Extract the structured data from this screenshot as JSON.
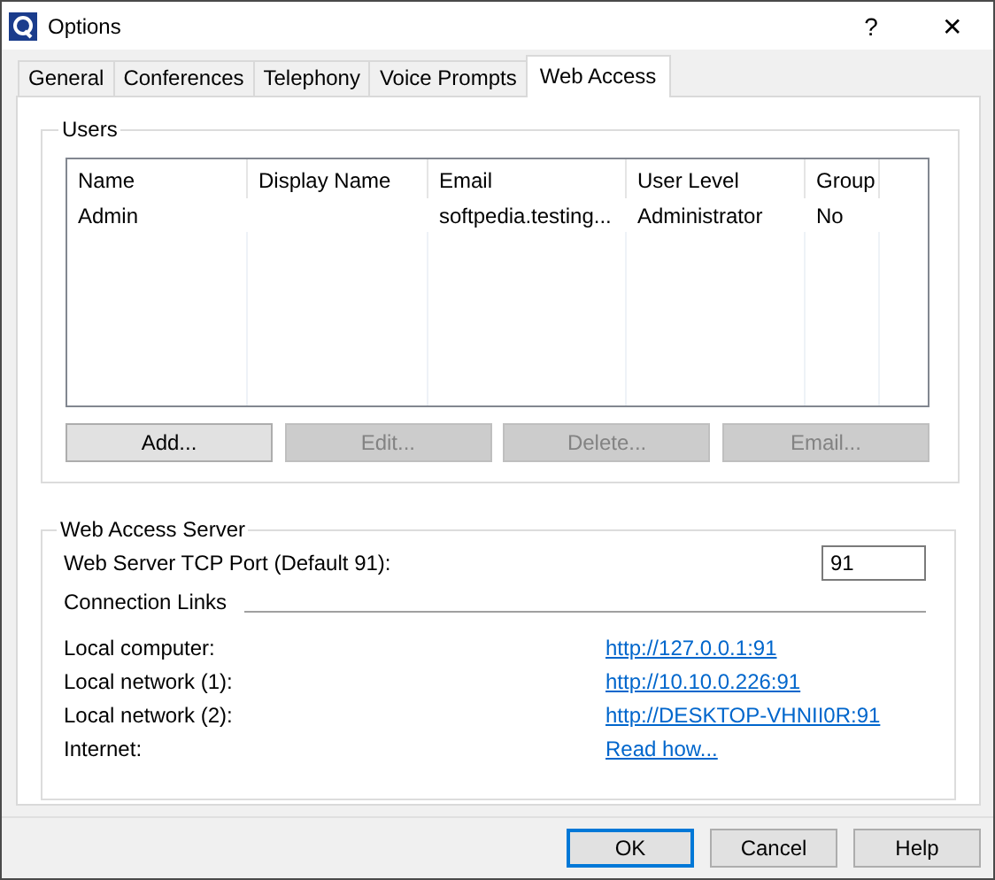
{
  "window": {
    "title": "Options",
    "help_glyph": "?",
    "close_glyph": "✕"
  },
  "tabs": [
    {
      "label": "General",
      "selected": false
    },
    {
      "label": "Conferences",
      "selected": false
    },
    {
      "label": "Telephony",
      "selected": false
    },
    {
      "label": "Voice Prompts",
      "selected": false
    },
    {
      "label": "Web Access",
      "selected": true
    }
  ],
  "users": {
    "title": "Users",
    "columns": [
      "Name",
      "Display Name",
      "Email",
      "User Level",
      "Group"
    ],
    "rows": [
      [
        "Admin",
        "",
        "softpedia.testing...",
        "Administrator",
        "No"
      ]
    ],
    "buttons": [
      {
        "label": "Add...",
        "disabled": false
      },
      {
        "label": "Edit...",
        "disabled": true
      },
      {
        "label": "Delete...",
        "disabled": true
      },
      {
        "label": "Email...",
        "disabled": true
      }
    ]
  },
  "server": {
    "title": "Web Access Server",
    "port_label": "Web Server TCP Port (Default 91):",
    "port_value": "91",
    "links_heading": "Connection Links",
    "links": [
      {
        "label": "Local computer:",
        "link": "http://127.0.0.1:91"
      },
      {
        "label": "Local network (1):",
        "link": "http://10.10.0.226:91"
      },
      {
        "label": "Local network (2):",
        "link": "http://DESKTOP-VHNII0R:91"
      },
      {
        "label": "Internet:",
        "link": "Read how..."
      }
    ]
  },
  "footer_buttons": [
    {
      "label": "OK",
      "default": true
    },
    {
      "label": "Cancel",
      "default": false
    },
    {
      "label": "Help",
      "default": false
    }
  ]
}
